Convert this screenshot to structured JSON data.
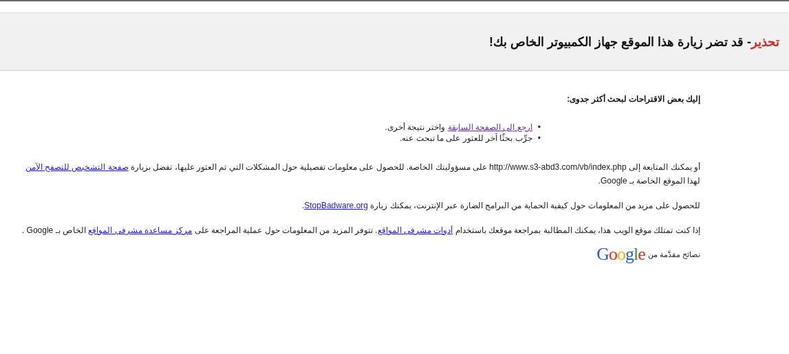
{
  "header": {
    "warning_label": "تحذير",
    "title": "- قد تضر زيارة هذا الموقع جهاز الكمبيوتر الخاص بك!"
  },
  "suggestions": {
    "heading": "إليك بعض الاقتراحات لبحث أكثر جدوى:",
    "bullet": "•",
    "items": [
      [
        {
          "kind": "link",
          "text": "ارجع إلى الصفحة السابقة"
        },
        {
          "kind": "text",
          "text": " واختر نتيجة أخرى."
        }
      ],
      [
        {
          "kind": "text",
          "text": "جرِّب بحثًا آخر للعثور على ما تبحث عنه."
        }
      ]
    ]
  },
  "paragraphs": [
    [
      {
        "kind": "text",
        "text": "أو يمكنك المتابعة إلى http://www.s3-abd3.com/vb/index.php على مسؤوليتك الخاصة. للحصول على معلومات تفصيلية حول المشكلات التي تم العثور عليها، تفضل بزيارة "
      },
      {
        "kind": "link",
        "text": "صفحة التشخيص للتصفح الآمن"
      },
      {
        "kind": "text",
        "text": " لهذا الموقع الخاصة بـ Google."
      }
    ],
    [
      {
        "kind": "text",
        "text": "للحصول على مزيد من المعلومات حول كيفية الحماية من البرامج الضارة عبر الإنترنت، يمكنك زيارة "
      },
      {
        "kind": "link",
        "text": "StopBadware.org"
      },
      {
        "kind": "text",
        "text": "."
      }
    ],
    [
      {
        "kind": "text",
        "text": "إذا كنت تمتلك موقع الويب هذا، يمكنك المطالبة بمراجعة موقعك باستخدام "
      },
      {
        "kind": "link",
        "text": "أدوات مشرفي المواقع"
      },
      {
        "kind": "text",
        "text": ". تتوفر المزيد من المعلومات حول عملية المراجعة على "
      },
      {
        "kind": "link",
        "text": "مركز مساعدة مشرفي المواقع"
      },
      {
        "kind": "text",
        "text": " الخاص بـ Google ."
      }
    ]
  ],
  "footer": {
    "caption": "نصائح مقدَّمة من",
    "logo": "Google"
  }
}
